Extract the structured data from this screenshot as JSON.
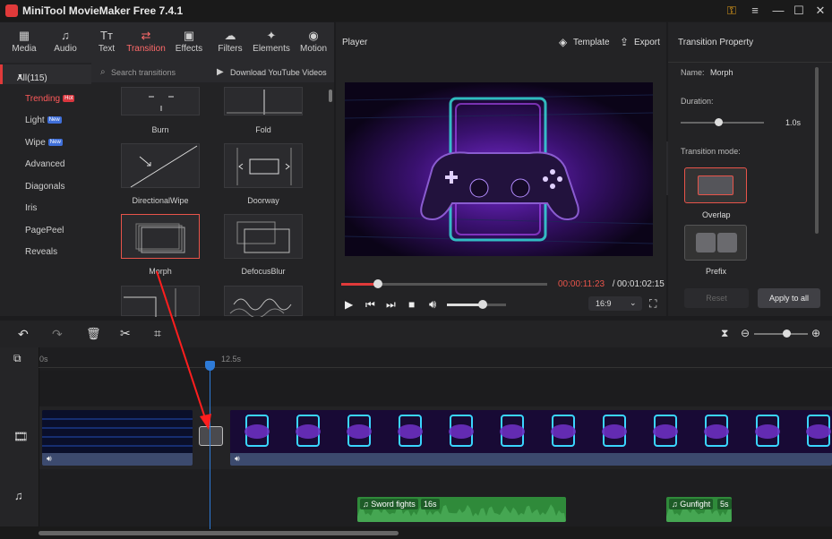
{
  "window": {
    "title": "MiniTool MovieMaker Free 7.4.1"
  },
  "tabs": [
    {
      "label": "Media",
      "icon": "media-icon"
    },
    {
      "label": "Audio",
      "icon": "music-icon"
    },
    {
      "label": "Text",
      "icon": "text-icon"
    },
    {
      "label": "Transition",
      "icon": "transition-icon"
    },
    {
      "label": "Effects",
      "icon": "effects-icon"
    },
    {
      "label": "Filters",
      "icon": "filters-icon"
    },
    {
      "label": "Elements",
      "icon": "elements-icon"
    },
    {
      "label": "Motion",
      "icon": "motion-icon"
    }
  ],
  "categories": {
    "all": "All(115)",
    "items": [
      "Trending",
      "Light",
      "Wipe",
      "Advanced",
      "Diagonals",
      "Iris",
      "PagePeel",
      "Reveals"
    ],
    "badges": {
      "hot": "Hot",
      "new": "New"
    }
  },
  "search": {
    "placeholder": "Search transitions",
    "download": "Download YouTube Videos"
  },
  "transitions": [
    "Burn",
    "Fold",
    "DirectionalWipe",
    "Doorway",
    "Morph",
    "DefocusBlur"
  ],
  "player": {
    "title": "Player",
    "template": "Template",
    "export": "Export",
    "current_time": "00:00:11:23",
    "separator": " / ",
    "total_time": "00:01:02:15",
    "aspect": "16:9",
    "progress": 0.18,
    "volume": 0.6
  },
  "property": {
    "title": "Transition Property",
    "name_label": "Name:",
    "name_value": "Morph",
    "duration_label": "Duration:",
    "duration_value": "1.0s",
    "duration_level": 0.45,
    "mode_label": "Transition mode:",
    "mode_overlap": "Overlap",
    "mode_prefix": "Prefix",
    "reset": "Reset",
    "apply": "Apply to all"
  },
  "timeline": {
    "ruler_start": "0s",
    "ruler_mark": "12.5s",
    "zoom_level": 0.6
  },
  "audio": [
    {
      "name": "Sword fights",
      "duration": "16s"
    },
    {
      "name": "Gunfight",
      "duration": "5s"
    }
  ],
  "colors": {
    "accent": "#e03a3a",
    "audio": "#2f8a3a",
    "playhead": "#2e7bd8"
  }
}
